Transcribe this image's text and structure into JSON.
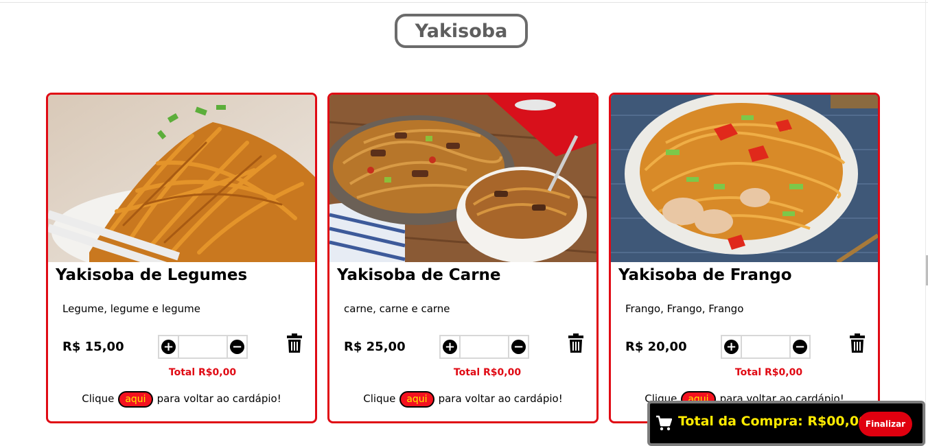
{
  "page": {
    "title": "Yakisoba"
  },
  "products": [
    {
      "name": "Yakisoba de Legumes",
      "description": "Legume, legume e legume",
      "price": "R$ 15,00",
      "quantity": "",
      "total": "Total R$0,00",
      "back_prefix": "Clique",
      "back_link": "aqui",
      "back_suffix": "para voltar ao cardápio!"
    },
    {
      "name": "Yakisoba de Carne",
      "description": "carne, carne e carne",
      "price": "R$ 25,00",
      "quantity": "",
      "total": "Total R$0,00",
      "back_prefix": "Clique",
      "back_link": "aqui",
      "back_suffix": "para voltar ao cardápio!"
    },
    {
      "name": "Yakisoba de Frango",
      "description": "Frango, Frango, Frango",
      "price": "R$ 20,00",
      "quantity": "",
      "total": "Total R$0,00",
      "back_prefix": "Clique",
      "back_link": "aqui",
      "back_suffix": "para voltar ao cardápio!"
    }
  ],
  "cart": {
    "label": "Total da Compra: R$00,00",
    "finalize_label": "Finalizar"
  },
  "colors": {
    "accent_red": "#e00a14",
    "cart_text": "#ffeb00",
    "link_text": "#ffe800"
  }
}
